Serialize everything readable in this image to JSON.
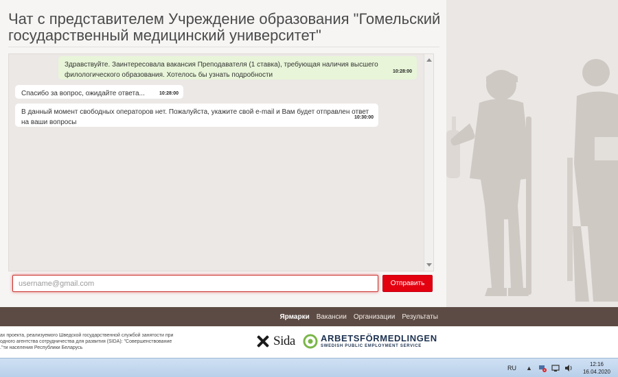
{
  "page": {
    "title": "Чат с представителем Учреждение образования \"Гомельский государственный медицинский университет\""
  },
  "chat": {
    "messages": [
      {
        "direction": "out",
        "text": "Здравствуйте. Заинтересовала вакансия Преподавателя (1 ставка), требующая наличия высшего филологического образования. Хотелось бы узнать подробности",
        "time": "10:28:00"
      },
      {
        "direction": "in",
        "text": "Спасибо за вопрос, ожидайте ответа...",
        "time": "10:28:00"
      },
      {
        "direction": "in",
        "text": "В данный момент свободных операторов нет. Пожалуйста, укажите свой e-mail и Вам будет отправлен ответ на ваши вопросы",
        "time": "10:30:00"
      }
    ],
    "input_placeholder": "username@gmail.com",
    "send_label": "Отправить"
  },
  "nav": {
    "items": [
      {
        "label": "Ярмарки",
        "active": true
      },
      {
        "label": "Вакансии",
        "active": false
      },
      {
        "label": "Организации",
        "active": false
      },
      {
        "label": "Результаты",
        "active": false
      }
    ]
  },
  "footer": {
    "text_lines": [
      "ах проекта, реализуемого Шведской государственной службой занятости при",
      "одного агентства сотрудничества для развития (SIDA): \"Совершенствование",
      "ти населения Республики Беларусь\"."
    ],
    "sida_logo": "Sida",
    "af_name": "ARBETSFÖRMEDLINGEN",
    "af_sub": "SWEDISH PUBLIC EMPLOYMENT SERVICE"
  },
  "taskbar": {
    "lang": "RU",
    "icons": [
      "tray-expand-icon",
      "network-warning-icon",
      "display-icon",
      "volume-icon"
    ],
    "time": "12:16",
    "date": "16.04.2020"
  },
  "colors": {
    "send_button": "#e3000f",
    "nav_bar": "#5c4b44",
    "outgoing_bubble": "#e8f5d8",
    "incoming_bubble": "#ffffff"
  }
}
